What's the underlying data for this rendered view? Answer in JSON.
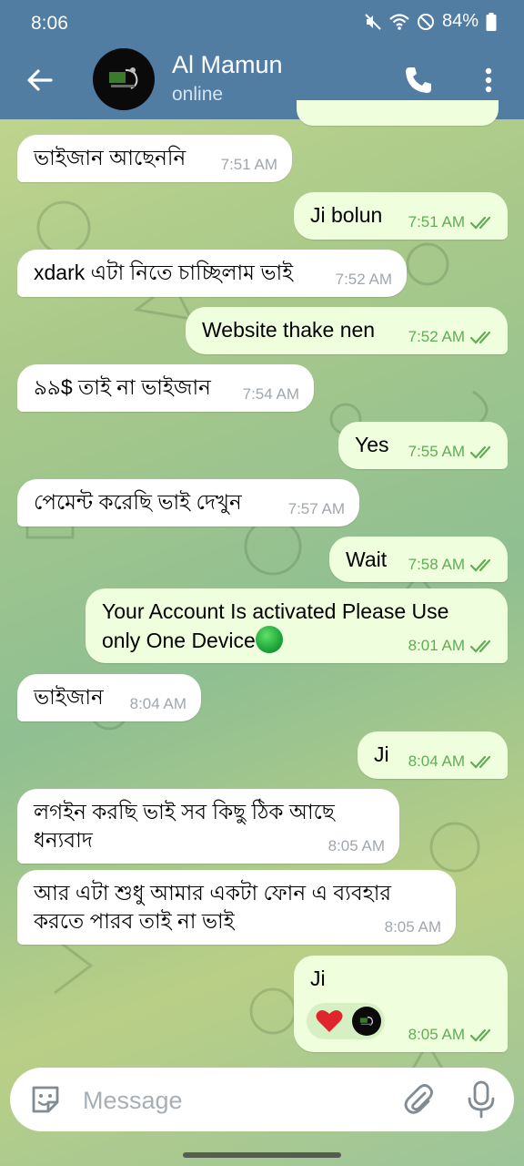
{
  "status_bar": {
    "time": "8:06",
    "battery": "84%"
  },
  "header": {
    "name": "Al Mamun",
    "status": "online"
  },
  "messages": [
    {
      "dir": "in",
      "text": "ভাইজান আছেননি",
      "time": "7:51 AM"
    },
    {
      "dir": "out",
      "text": "Ji bolun",
      "time": "7:51 AM"
    },
    {
      "dir": "in",
      "text": "xdark এটা নিতে চাচ্ছিলাম ভাই",
      "time": "7:52 AM"
    },
    {
      "dir": "out",
      "text": "Website thake nen",
      "time": "7:52 AM"
    },
    {
      "dir": "in",
      "text": "৯৯$ তাই না ভাইজান",
      "time": "7:54 AM"
    },
    {
      "dir": "out",
      "text": "Yes",
      "time": "7:55 AM"
    },
    {
      "dir": "in",
      "text": "পেমেন্ট করেছি ভাই দেখুন",
      "time": "7:57 AM"
    },
    {
      "dir": "out",
      "text": "Wait",
      "time": "7:58 AM"
    },
    {
      "dir": "out",
      "line1": "Your Account Is activated Please Use",
      "line2": "only One Device",
      "time": "8:01 AM"
    },
    {
      "dir": "in",
      "text": "ভাইজান",
      "time": "8:04 AM"
    },
    {
      "dir": "out",
      "text": "Ji",
      "time": "8:04 AM"
    },
    {
      "dir": "in",
      "line1": "লগইন করছি ভাই সব কিছু ঠিক আছে",
      "line2": "ধন্যবাদ",
      "time": "8:05 AM"
    },
    {
      "dir": "in",
      "line1": "আর এটা শুধু আমার একটা ফোন এ ব্যবহার",
      "line2": "করতে পারব তাই না ভাই",
      "time": "8:05 AM"
    },
    {
      "dir": "out",
      "text": "Ji",
      "time": "8:05 AM",
      "reaction": "heart"
    }
  ],
  "input": {
    "placeholder": "Message"
  },
  "colors": {
    "header": "#517da2",
    "outgoing_bubble": "#effedd",
    "incoming_bubble": "#ffffff",
    "read_ticks": "#62ac55"
  }
}
